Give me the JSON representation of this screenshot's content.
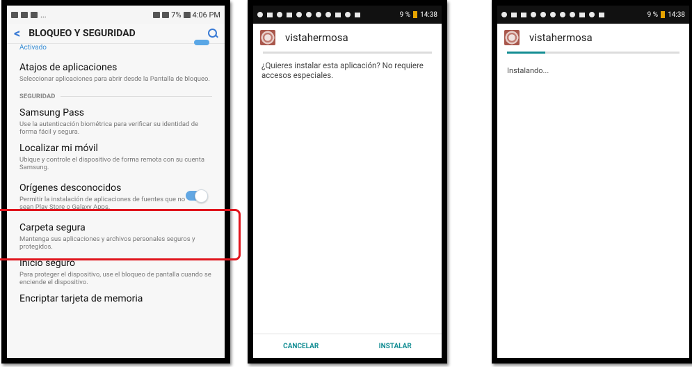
{
  "phone1": {
    "status_bar": {
      "carrier": "...",
      "battery": "7%",
      "time": "4:06 PM"
    },
    "app_bar": {
      "back": "<",
      "title": "BLOQUEO Y SEGURIDAD"
    },
    "activado": "Activado",
    "items": [
      {
        "title": "Atajos de aplicaciones",
        "subtitle": "Seleccionar aplicaciones para abrir desde la Pantalla de bloqueo."
      }
    ],
    "section": "SEGURIDAD",
    "security_items": [
      {
        "title": "Samsung Pass",
        "subtitle": "Use la autenticación biométrica para verificar su identidad de forma fácil y segura."
      },
      {
        "title": "Localizar mi móvil",
        "subtitle": "Ubique y controle el dispositivo de forma remota con su cuenta Samsung."
      },
      {
        "title": "Orígenes desconocidos",
        "subtitle": "Permitir la instalación de aplicaciones de fuentes que no sean Play Store o Galaxy Apps."
      },
      {
        "title": "Carpeta segura",
        "subtitle": "Mantenga sus aplicaciones y archivos personales seguros y protegidos."
      },
      {
        "title": "Inicio seguro",
        "subtitle": "Para proteger el dispositivo, use el bloqueo de pantalla cuando se enciende el dispositivo."
      },
      {
        "title": "Encriptar tarjeta de memoria",
        "subtitle": ""
      }
    ]
  },
  "phone2": {
    "status_bar": {
      "battery": "9 %",
      "time": "14:38"
    },
    "app_name": "vistahermosa",
    "prompt": "¿Quieres instalar esta aplicación? No requiere accesos especiales.",
    "cancel_label": "CANCELAR",
    "install_label": "INSTALAR"
  },
  "phone3": {
    "status_bar": {
      "battery": "9 %",
      "time": "14:38"
    },
    "app_name": "vistahermosa",
    "status": "Instalando...",
    "progress": 0.22
  },
  "colors": {
    "accent": "#138d93",
    "highlight": "#e0141c",
    "toggle": "#62a7e3"
  }
}
